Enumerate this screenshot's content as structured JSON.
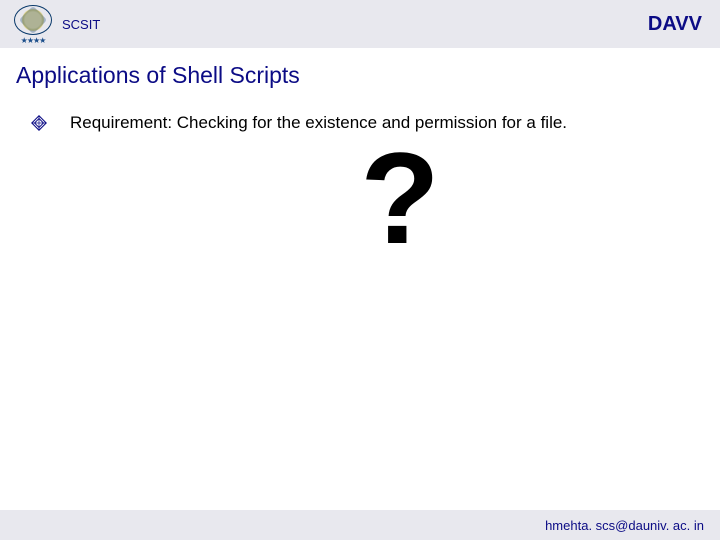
{
  "header": {
    "left_label": "SCSIT",
    "right_label": "DAVV"
  },
  "title": "Applications of Shell Scripts",
  "content": {
    "bullet_text": "Requirement: Checking for the existence and permission for a file.",
    "question_symbol": "?"
  },
  "footer": {
    "email": "hmehta. scs@dauniv. ac. in"
  }
}
